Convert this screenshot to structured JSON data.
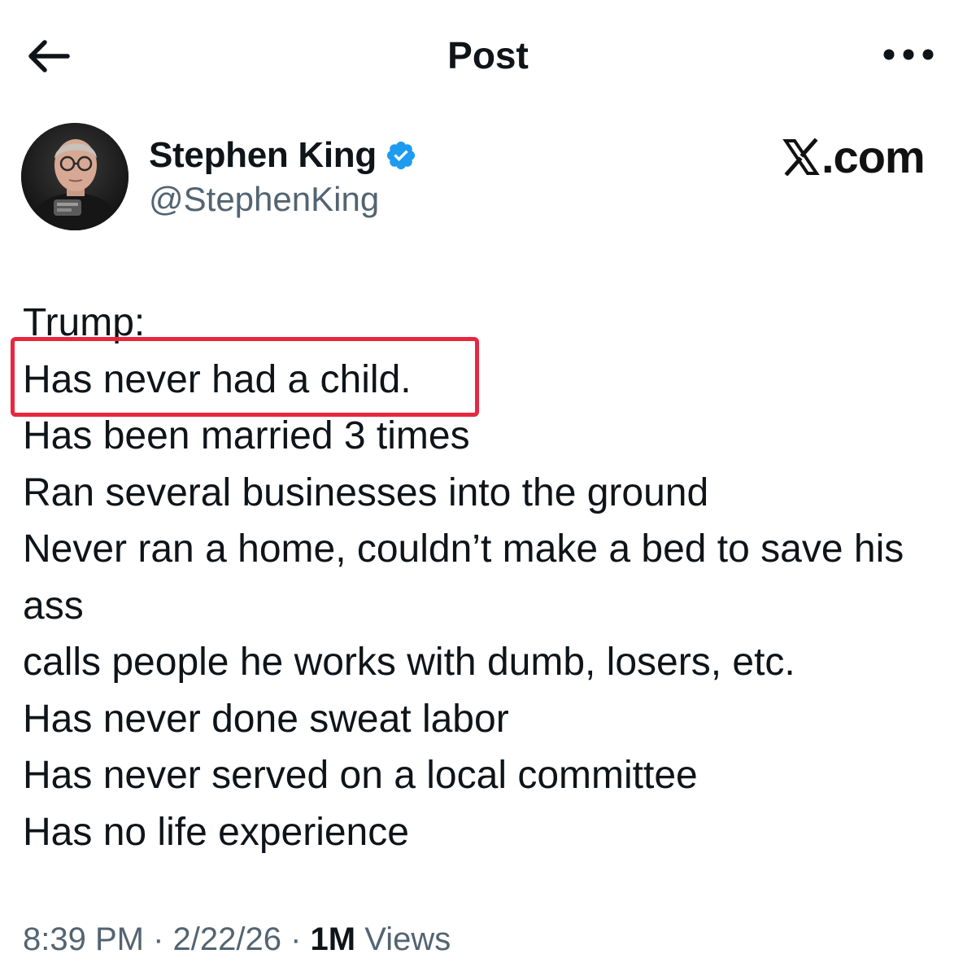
{
  "header": {
    "title": "Post"
  },
  "author": {
    "name": "Stephen King",
    "handle": "@StephenKing",
    "verified_color": "#1d9bf0"
  },
  "watermark": {
    "text": ".com",
    "logo_icon": "x-logo-icon"
  },
  "post": {
    "lines": [
      "Trump:",
      "Has never had a child.",
      "Has been married 3 times",
      "Ran several businesses into the ground",
      "Never ran a home, couldn’t make a bed to save his",
      "ass",
      "calls people he works with dumb, losers, etc.",
      "Has never done sweat labor",
      "Has never served on a local committee",
      "Has no life experience"
    ],
    "highlight_color": "#e8273f"
  },
  "meta": {
    "time": "8:39 PM",
    "separator": " · ",
    "date": "2/22/26",
    "views_count": "1M",
    "views_label": "Views"
  }
}
